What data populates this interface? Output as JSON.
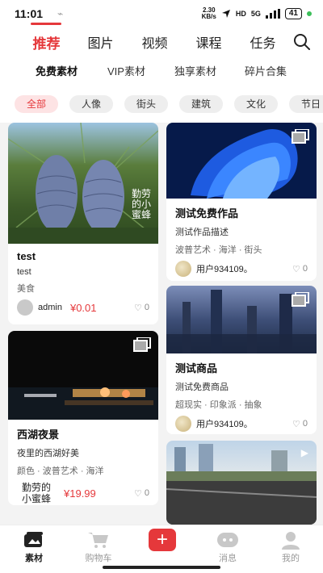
{
  "status": {
    "time": "11:01",
    "net_speed_value": "2.30",
    "net_speed_unit": "KB/s",
    "network": "5G",
    "battery": "41"
  },
  "main_tabs": [
    {
      "label": "推荐",
      "active": true
    },
    {
      "label": "图片",
      "active": false
    },
    {
      "label": "视频",
      "active": false
    },
    {
      "label": "课程",
      "active": false
    },
    {
      "label": "任务",
      "active": false
    }
  ],
  "sub_tabs": [
    {
      "label": "免费素材",
      "active": true
    },
    {
      "label": "VIP素材",
      "active": false
    },
    {
      "label": "独享素材",
      "active": false
    },
    {
      "label": "碎片合集",
      "active": false
    }
  ],
  "chips": [
    {
      "label": "全部",
      "active": true
    },
    {
      "label": "人像",
      "active": false
    },
    {
      "label": "街头",
      "active": false
    },
    {
      "label": "建筑",
      "active": false
    },
    {
      "label": "文化",
      "active": false
    },
    {
      "label": "节日",
      "active": false
    }
  ],
  "cards": [
    {
      "title": "test",
      "desc": "test",
      "tags": "美食",
      "user": "admin",
      "price": "¥0.01",
      "likes": "0",
      "image_caption": "勤劳的小蜜蜂"
    },
    {
      "title": "测试免费作品",
      "desc": "测试作品描述",
      "tags": "波普艺术 · 海洋 · 街头",
      "user": "用户934109。",
      "likes": "0"
    },
    {
      "title": "西湖夜景",
      "desc": "夜里的西湖好美",
      "tags": "颜色 · 波普艺术 · 海洋",
      "user_line1": "勤劳的",
      "user_line2": "小蜜蜂",
      "price": "¥19.99",
      "likes": "0"
    },
    {
      "title": "测试商品",
      "desc": "测试免费商品",
      "tags": "超现实 · 印象派 · 抽象",
      "user": "用户934109。",
      "likes": "0"
    }
  ],
  "bottom_nav": [
    {
      "label": "素材",
      "icon": "material-icon",
      "active": true
    },
    {
      "label": "购物车",
      "icon": "cart-icon",
      "active": false
    },
    {
      "label": "",
      "icon": "plus-icon",
      "active": false
    },
    {
      "label": "消息",
      "icon": "message-icon",
      "active": false
    },
    {
      "label": "我的",
      "icon": "profile-icon",
      "active": false
    }
  ],
  "colors": {
    "accent": "#e5383b",
    "chip_bg": "#eeeeee",
    "chip_active_bg": "#fde3e4",
    "feed_bg": "#f3f3f3"
  }
}
